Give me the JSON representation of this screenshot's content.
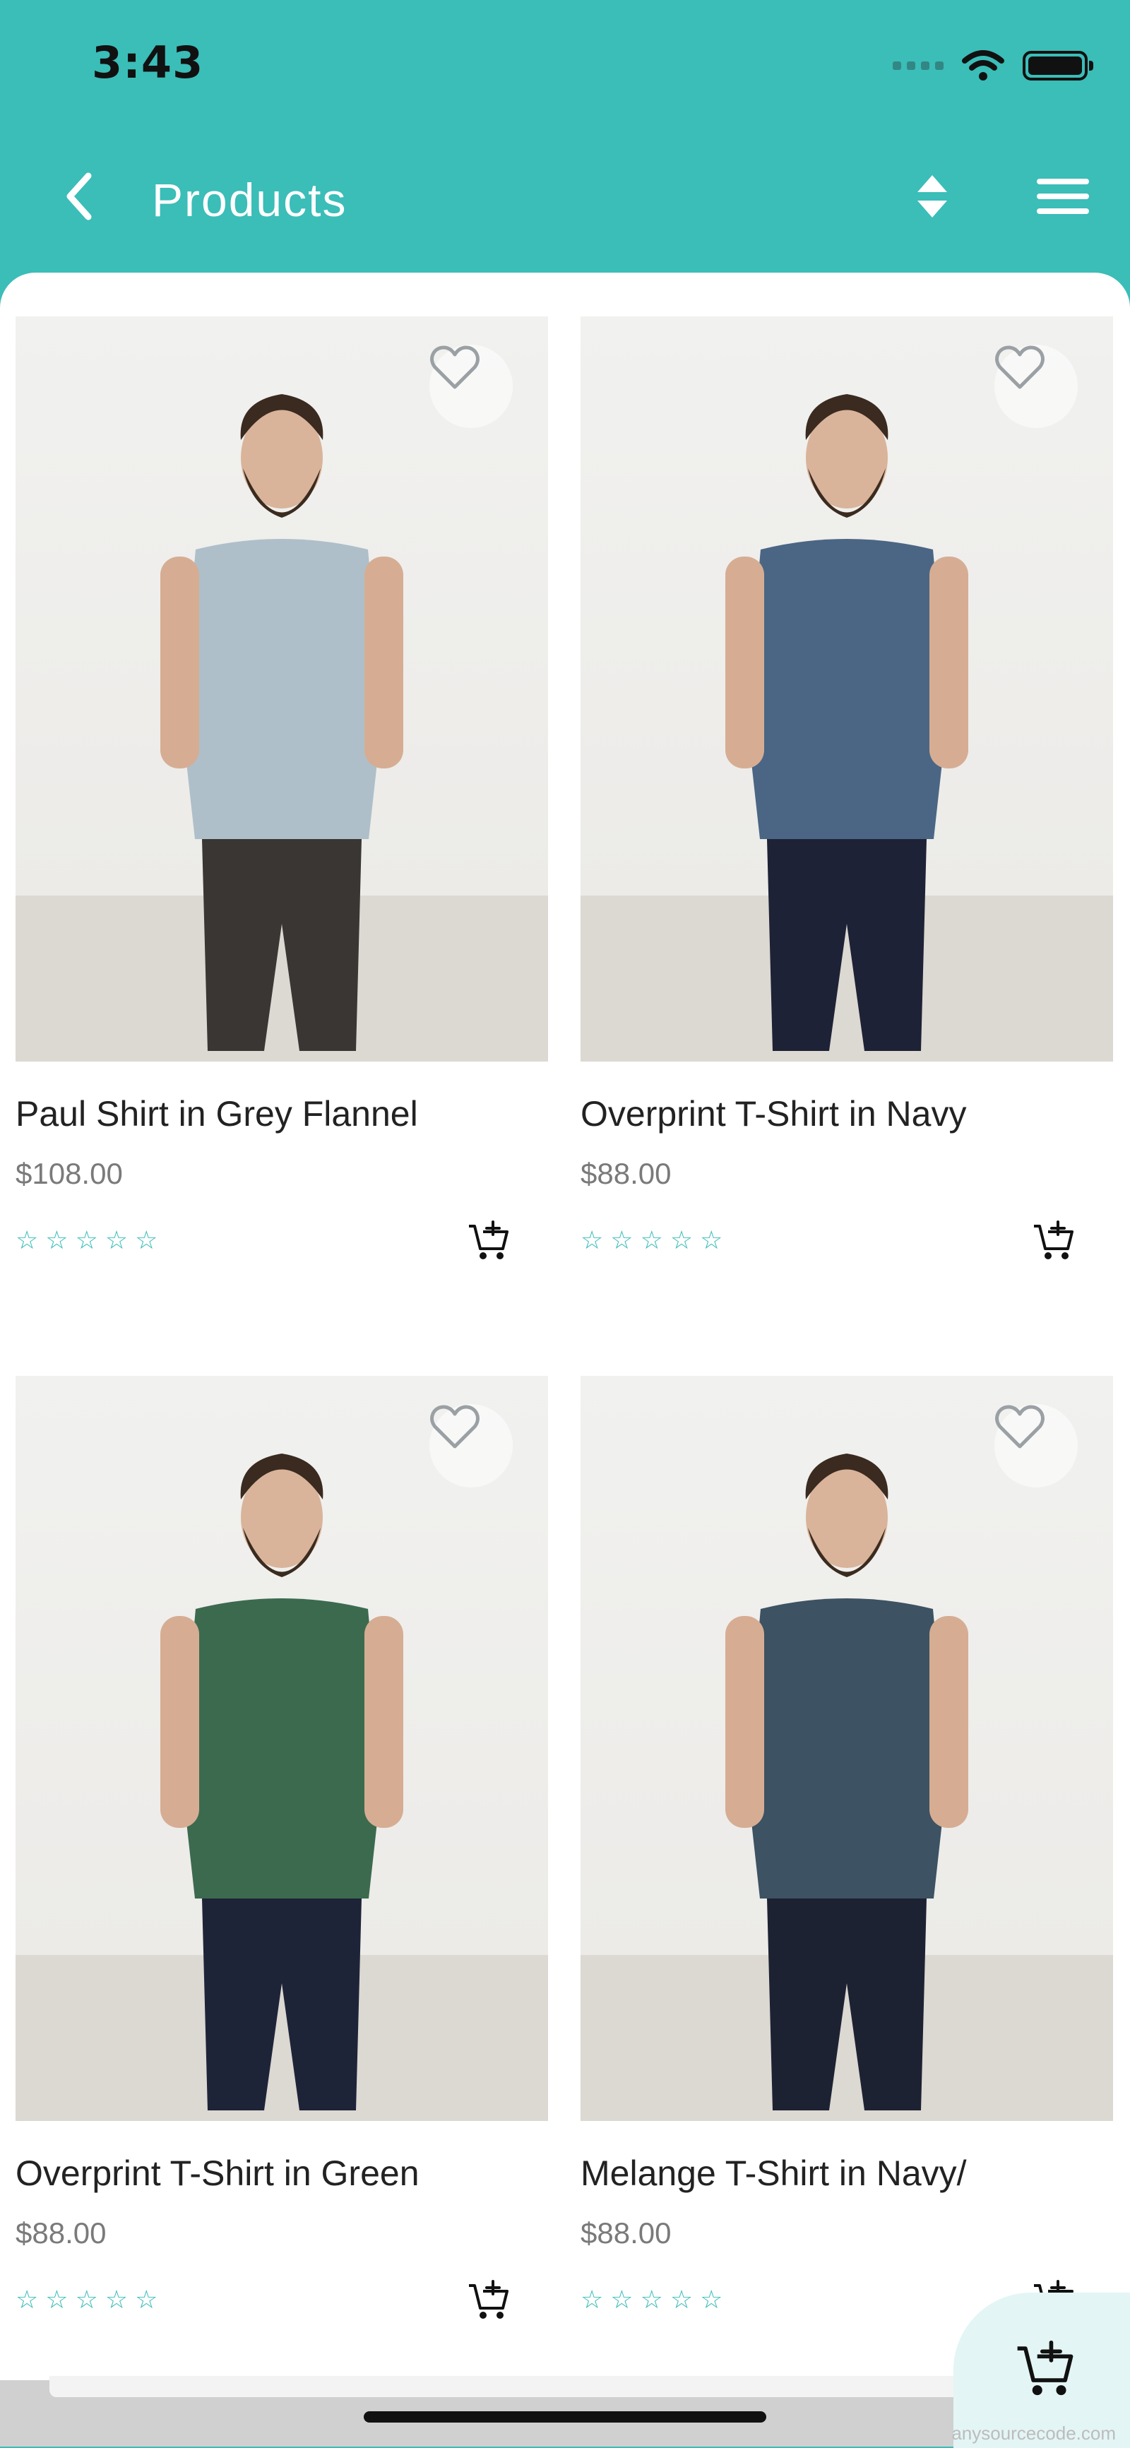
{
  "status_bar": {
    "time": "3:43"
  },
  "app_bar": {
    "title": "Products"
  },
  "products": [
    {
      "name": "Paul Shirt in Grey Flannel",
      "price": "$108.00",
      "rating": 0,
      "shirt_color": "#aebfc9",
      "pants_color": "#3a3634"
    },
    {
      "name": "Overprint T-Shirt in Navy",
      "price": "$88.00",
      "rating": 0,
      "shirt_color": "#4b6684",
      "pants_color": "#1e2236"
    },
    {
      "name": "Overprint T-Shirt in Green",
      "price": "$88.00",
      "rating": 0,
      "shirt_color": "#3c6a4f",
      "pants_color": "#1e2438"
    },
    {
      "name": "Melange T-Shirt in Navy/",
      "price": "$88.00",
      "rating": 0,
      "shirt_color": "#3d5262",
      "pants_color": "#1d2233"
    }
  ],
  "watermark": "anysourcecode.com",
  "colors": {
    "accent": "#3bbdb8",
    "header_bg": "#3bbdb8",
    "fab_bg": "#e3f5f4"
  },
  "icons": {
    "back": "chevron-left-icon",
    "sort": "sort-icon",
    "menu": "hamburger-menu-icon",
    "favorite": "heart-outline-icon",
    "cart": "add-to-cart-icon",
    "star": "star-outline-icon"
  }
}
